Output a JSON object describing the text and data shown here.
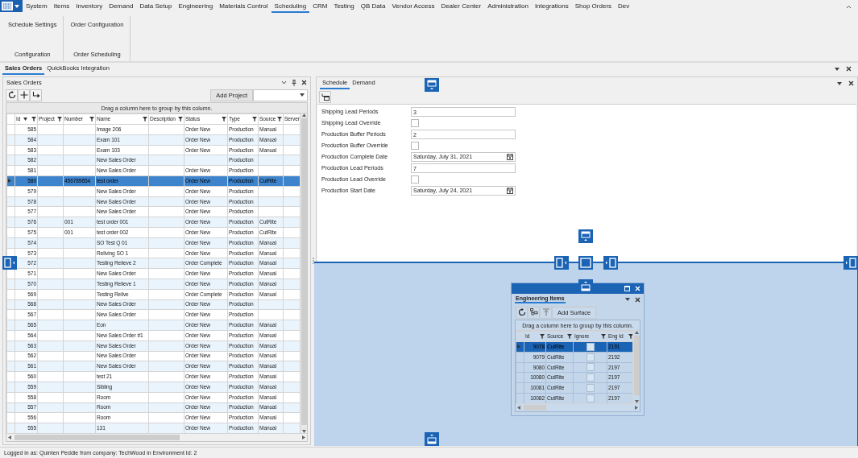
{
  "menu": [
    {
      "label": "System",
      "selected": false
    },
    {
      "label": "Items",
      "selected": false
    },
    {
      "label": "Inventory",
      "selected": false
    },
    {
      "label": "Demand",
      "selected": false
    },
    {
      "label": "Data Setup",
      "selected": false
    },
    {
      "label": "Engineering",
      "selected": false
    },
    {
      "label": "Materials Control",
      "selected": false
    },
    {
      "label": "Scheduling",
      "selected": true
    },
    {
      "label": "CRM",
      "selected": false
    },
    {
      "label": "Testing",
      "selected": false
    },
    {
      "label": "QB Data",
      "selected": false
    },
    {
      "label": "Vendor Access",
      "selected": false
    },
    {
      "label": "Dealer Center",
      "selected": false
    },
    {
      "label": "Administration",
      "selected": false
    },
    {
      "label": "Integrations",
      "selected": false
    },
    {
      "label": "Shop Orders",
      "selected": false
    },
    {
      "label": "Dev",
      "selected": false
    }
  ],
  "ribbon": [
    {
      "button": "Schedule Settings",
      "group": "Configuration"
    },
    {
      "button": "Order Configuration",
      "group": "Order Scheduling"
    }
  ],
  "doc_tabs": [
    {
      "label": "Sales Orders",
      "selected": true
    },
    {
      "label": "QuickBooks Integration",
      "selected": false
    }
  ],
  "sales_orders": {
    "title": "Sales Orders",
    "add_button": "Add Project",
    "group_hint": "Drag a column here to group by this column.",
    "columns": [
      {
        "label": "Id",
        "sorted": true
      },
      {
        "label": "Project",
        "sorted": false
      },
      {
        "label": "Number",
        "sorted": false
      },
      {
        "label": "Name",
        "sorted": false
      },
      {
        "label": "Description",
        "sorted": false
      },
      {
        "label": "Status",
        "sorted": false
      },
      {
        "label": "Type",
        "sorted": false
      },
      {
        "label": "Source",
        "sorted": false
      },
      {
        "label": "Server",
        "sorted": false
      }
    ],
    "rows": [
      {
        "id": "585",
        "name": "Image 206",
        "status": "Order New",
        "type": "Production",
        "source": "Manual",
        "selected": false
      },
      {
        "id": "584",
        "name": "Exam 101",
        "status": "Order New",
        "type": "Production",
        "source": "Manual",
        "selected": false
      },
      {
        "id": "583",
        "name": "Exam 103",
        "status": "Order New",
        "type": "Production",
        "source": "Manual",
        "selected": false
      },
      {
        "id": "582",
        "name": "New Sales Order",
        "type": "Production",
        "selected": false
      },
      {
        "id": "581",
        "name": "New Sales Order",
        "status": "Order New",
        "type": "Production",
        "selected": false
      },
      {
        "id": "580",
        "number": "456789654",
        "name": "test order",
        "status": "Order New",
        "type": "Production",
        "source": "CutRite",
        "selected": true
      },
      {
        "id": "579",
        "name": "New Sales Order",
        "status": "Order New",
        "type": "Production",
        "selected": false
      },
      {
        "id": "578",
        "name": "New Sales Order",
        "status": "Order New",
        "type": "Production",
        "selected": false
      },
      {
        "id": "577",
        "name": "New Sales Order",
        "status": "Order New",
        "type": "Production",
        "selected": false
      },
      {
        "id": "576",
        "number": "001",
        "name": "test order 001",
        "status": "Order New",
        "type": "Production",
        "source": "CutRite",
        "selected": false
      },
      {
        "id": "575",
        "number": "001",
        "name": "test order 002",
        "status": "Order New",
        "type": "Production",
        "source": "CutRite",
        "selected": false
      },
      {
        "id": "574",
        "name": "SO Test Q 01",
        "status": "Order New",
        "type": "Production",
        "source": "Manual",
        "selected": false
      },
      {
        "id": "573",
        "name": "Reliving SO 1",
        "status": "Order New",
        "type": "Production",
        "source": "Manual",
        "selected": false
      },
      {
        "id": "572",
        "name": "Testing Relieve 2",
        "status": "Order Complete",
        "type": "Production",
        "source": "Manual",
        "selected": false
      },
      {
        "id": "571",
        "name": "New Sales Order",
        "status": "Order New",
        "type": "Production",
        "source": "Manual",
        "selected": false
      },
      {
        "id": "570",
        "name": "Testing Relieve 1",
        "status": "Order New",
        "type": "Production",
        "source": "Manual",
        "selected": false
      },
      {
        "id": "569",
        "name": "Testing Relive",
        "status": "Order Complete",
        "type": "Production",
        "source": "Manual",
        "selected": false
      },
      {
        "id": "568",
        "name": "New Sales Order",
        "status": "Order New",
        "type": "Production",
        "selected": false
      },
      {
        "id": "567",
        "name": "New Sales Order",
        "status": "Order New",
        "type": "Production",
        "selected": false
      },
      {
        "id": "565",
        "name": "Eon",
        "status": "Order New",
        "type": "Production",
        "source": "Manual",
        "selected": false
      },
      {
        "id": "564",
        "name": "New Sales Order #1",
        "status": "Order New",
        "type": "Production",
        "source": "Manual",
        "selected": false
      },
      {
        "id": "563",
        "name": "New Sales Order",
        "status": "Order New",
        "type": "Production",
        "source": "Manual",
        "selected": false
      },
      {
        "id": "562",
        "name": "New Sales Order",
        "status": "Order New",
        "type": "Production",
        "source": "Manual",
        "selected": false
      },
      {
        "id": "561",
        "name": "New Sales Order",
        "status": "Order New",
        "type": "Production",
        "source": "Manual",
        "selected": false
      },
      {
        "id": "560",
        "name": "test 21",
        "status": "Order New",
        "type": "Production",
        "source": "Manual",
        "selected": false
      },
      {
        "id": "559",
        "name": "Sibling",
        "status": "Order New",
        "type": "Production",
        "source": "Manual",
        "selected": false
      },
      {
        "id": "558",
        "name": "Room",
        "status": "Order New",
        "type": "Production",
        "source": "Manual",
        "selected": false
      },
      {
        "id": "557",
        "name": "Room",
        "status": "Order New",
        "type": "Production",
        "source": "Manual",
        "selected": false
      },
      {
        "id": "556",
        "name": "Room",
        "status": "Order New",
        "type": "Production",
        "source": "Manual",
        "selected": false
      },
      {
        "id": "555",
        "name": "131",
        "status": "Order New",
        "type": "Production",
        "source": "Manual",
        "selected": false
      }
    ]
  },
  "detail_tabs": [
    {
      "label": "Schedule",
      "selected": true
    },
    {
      "label": "Demand",
      "selected": false
    }
  ],
  "schedule_fields": [
    {
      "label": "Shipping Lead Periods",
      "kind": "text",
      "value": "3"
    },
    {
      "label": "Shipping Lead Override",
      "kind": "checkbox",
      "checked": false
    },
    {
      "label": "Production Buffer Periods",
      "kind": "text",
      "value": "2"
    },
    {
      "label": "Production Buffer Override",
      "kind": "checkbox",
      "checked": false
    },
    {
      "label": "Production Complete Date",
      "kind": "date",
      "value": "Saturday, July 31, 2021"
    },
    {
      "label": "Production Lead Periods",
      "kind": "text",
      "value": "7"
    },
    {
      "label": "Production Lead Override",
      "kind": "checkbox",
      "checked": false
    },
    {
      "label": "Production Start Date",
      "kind": "date",
      "value": "Saturday, July 24, 2021"
    }
  ],
  "engineering_items": {
    "title": "Engineering Items",
    "add_button": "Add Surface",
    "group_hint": "Drag a column here to group by this column.",
    "columns": [
      "Id",
      "Source",
      "Ignore",
      "Eng Id"
    ],
    "rows": [
      {
        "id": "9078",
        "source": "CutRite",
        "checked": false,
        "eng_id": "2191",
        "selected": true
      },
      {
        "id": "9079",
        "source": "CutRite",
        "checked": false,
        "eng_id": "2192",
        "selected": false
      },
      {
        "id": "9080",
        "source": "CutRite",
        "checked": false,
        "eng_id": "2197",
        "selected": false
      },
      {
        "id": "10080",
        "source": "CutRite",
        "checked": false,
        "eng_id": "2197",
        "selected": false
      },
      {
        "id": "10081",
        "source": "CutRite",
        "checked": false,
        "eng_id": "2197",
        "selected": false
      },
      {
        "id": "10082",
        "source": "CutRite",
        "checked": false,
        "eng_id": "2197",
        "selected": false
      }
    ]
  },
  "status_bar": "Logged in as: Quinten Peddie  from company: TechWood in Environment Id: 2"
}
